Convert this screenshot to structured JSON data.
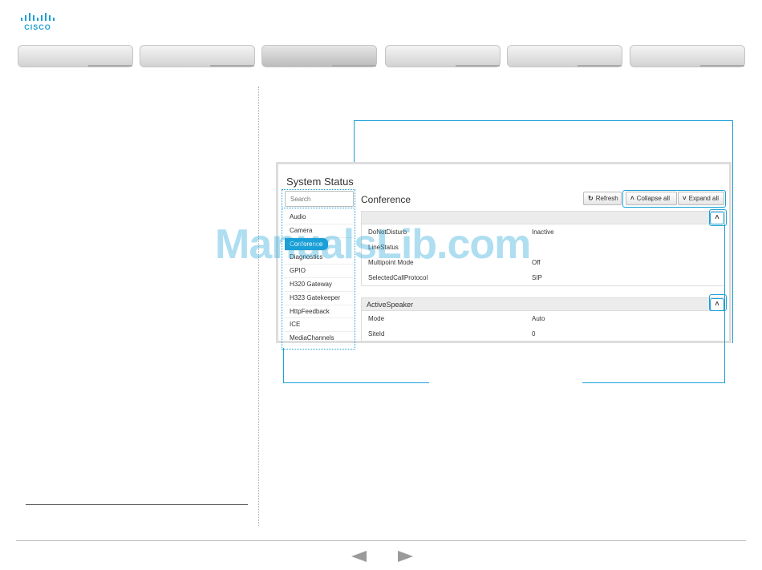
{
  "brand": {
    "name": "CISCO",
    "color": "#1ba0d7"
  },
  "screenshot": {
    "title": "System Status",
    "search_placeholder": "Search",
    "list": [
      "Audio",
      "Camera",
      "Conference",
      "Diagnostics",
      "GPIO",
      "H320 Gateway",
      "H323 Gatekeeper",
      "HttpFeedback",
      "ICE",
      "MediaChannels"
    ],
    "active_item": "Conference",
    "heading": "Conference",
    "buttons": {
      "refresh": "Refresh",
      "collapse": "Collapse all",
      "expand": "Expand all"
    },
    "sections": [
      {
        "name": "",
        "rows": [
          {
            "key": "DoNotDisturb",
            "value": "Inactive"
          },
          {
            "key": "LineStatus",
            "value": ""
          },
          {
            "key": "Multipoint Mode",
            "value": "Off"
          },
          {
            "key": "SelectedCallProtocol",
            "value": "SIP"
          }
        ]
      },
      {
        "name": "ActiveSpeaker",
        "rows": [
          {
            "key": "Mode",
            "value": "Auto"
          },
          {
            "key": "SiteId",
            "value": "0"
          }
        ]
      }
    ]
  },
  "watermark": "ManualsLib.com",
  "icons": {
    "prev": "prev-page-arrow-icon",
    "next": "next-page-arrow-icon"
  }
}
